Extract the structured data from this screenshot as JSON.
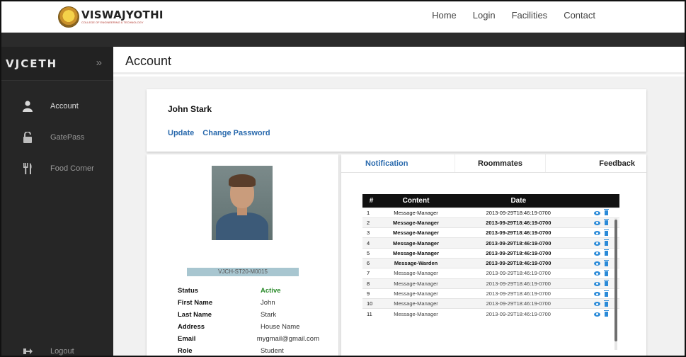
{
  "brand": {
    "logo_name": "VISWAJYOTHI",
    "logo_subtitle": "COLLEGE OF ENGINEERING & TECHNOLOGY",
    "sidebar_title": "VJCETH"
  },
  "nav": {
    "items": [
      "Home",
      "Login",
      "Facilities",
      "Contact"
    ]
  },
  "sidebar": {
    "items": [
      {
        "label": "Account",
        "icon": "user-icon"
      },
      {
        "label": "GatePass",
        "icon": "unlock-icon"
      },
      {
        "label": "Food Corner",
        "icon": "cutlery-icon"
      }
    ],
    "logout": {
      "label": "Logout",
      "icon": "logout-icon"
    }
  },
  "page": {
    "title": "Account"
  },
  "profile_header": {
    "name": "John Stark",
    "update_link": "Update",
    "change_password_link": "Change Password"
  },
  "profile": {
    "id": "VJCH-ST20-M0015",
    "fields": [
      {
        "key": "Status",
        "value": "Active"
      },
      {
        "key": "First Name",
        "value": "John"
      },
      {
        "key": "Last Name",
        "value": "Stark"
      },
      {
        "key": "Address",
        "value": "House Name"
      },
      {
        "key": "Email",
        "value": "mygmail@gmail.com"
      },
      {
        "key": "Role",
        "value": "Student"
      }
    ]
  },
  "tabs": {
    "notification": "Notification",
    "roommates": "Roommates",
    "feedback": "Feedback"
  },
  "table": {
    "headers": [
      "#",
      "Content",
      "Date"
    ],
    "rows": [
      {
        "n": "1",
        "content": "Message-Manager",
        "date": "2013-09-29T18:46:19-0700"
      },
      {
        "n": "2",
        "content": "Message-Manager",
        "date": "2013-09-29T18:46:19-0700"
      },
      {
        "n": "3",
        "content": "Message-Manager",
        "date": "2013-09-29T18:46:19-0700"
      },
      {
        "n": "4",
        "content": "Message-Manager",
        "date": "2013-09-29T18:46:19-0700"
      },
      {
        "n": "5",
        "content": "Message-Manager",
        "date": "2013-09-29T18:46:19-0700"
      },
      {
        "n": "6",
        "content": "Message-Warden",
        "date": "2013-09-29T18:46:19-0700"
      },
      {
        "n": "7",
        "content": "Message-Manager",
        "date": "2013-09-29T18:46:19-0700"
      },
      {
        "n": "8",
        "content": "Message-Manager",
        "date": "2013-09-29T18:46:19-0700"
      },
      {
        "n": "9",
        "content": "Message-Manager",
        "date": "2013-09-29T18:46:19-0700"
      },
      {
        "n": "10",
        "content": "Message-Manager",
        "date": "2013-09-29T18:46:19-0700"
      },
      {
        "n": "11",
        "content": "Message-Manager",
        "date": "2013-09-29T18:46:19-0700"
      }
    ]
  },
  "colors": {
    "link": "#2a6aad",
    "active_status": "#2a8a2a",
    "sidebar_bg": "#262626",
    "id_bar": "#a8c6d0"
  }
}
